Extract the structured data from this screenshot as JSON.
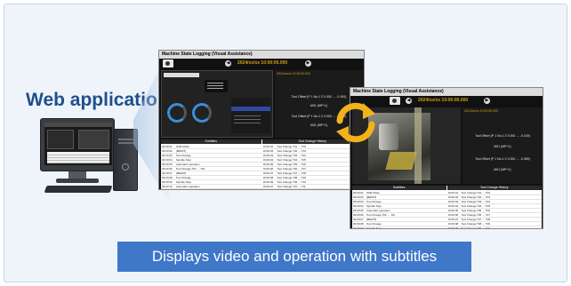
{
  "heading": "Web application",
  "caption": "Displays video and operation with subtitles",
  "window_main": {
    "title": "Machine State Logging (Visual Assistance)",
    "date": "2024/xx/xx 10:00:00.000",
    "info_top": "2024/xx/xx 10:00:00.000",
    "info_lines": [
      "Tool Offset (P 1 No.1 Z 0.000 → -0.100)",
      "M01 (MP+1)",
      "Tool Offset (P 1 No.1 Z 0.000 → -0.080)",
      "M01 (MP+1)"
    ]
  },
  "window_video": {
    "title": "Machine State Logging (Visual Assistance)",
    "date": "2024/xx/xx 10:00:00.000",
    "info_top": "2024/xx/xx 10:00:00.000",
    "info_lines": [
      "Tool Offset (P 1 No.1 Z 0.000 → -0.100)",
      "M01 (MP+1)",
      "Tool Offset (P 1 No.1 Z 0.000 → -0.080)",
      "M01 (MP+1)"
    ]
  },
  "table": {
    "col_subtitles": "Subtitles",
    "col_history": "Tool Change History",
    "rows": [
      {
        "t": "09:00:01",
        "s": "ONE Mode",
        "t2": "09:00:01",
        "h": "Tool Change T01 → T02"
      },
      {
        "t": "09:00:02",
        "s": "[MEM/T]",
        "t2": "09:00:02",
        "h": "Tool Change T02 → T03"
      },
      {
        "t": "09:00:03",
        "s": "Tool Change",
        "t2": "09:00:03",
        "h": "Tool Change T03 → T04"
      },
      {
        "t": "09:00:04",
        "s": "Spindle Stop",
        "t2": "09:00:04",
        "h": "Tool Change T04 → T05"
      },
      {
        "t": "09:00:05",
        "s": "Automatic operation",
        "t2": "09:00:05",
        "h": "Tool Change T05 → T06"
      },
      {
        "t": "09:00:06",
        "s": "Tool Change T02 → T03",
        "t2": "09:00:06",
        "h": "Tool Change T06 → T07"
      },
      {
        "t": "09:00:07",
        "s": "[MEM/T]",
        "t2": "09:00:07",
        "h": "Tool Change T07 → T08"
      },
      {
        "t": "09:00:08",
        "s": "Tool Change",
        "t2": "09:00:08",
        "h": "Tool Change T08 → T09"
      },
      {
        "t": "09:00:09",
        "s": "Spindle Stop",
        "t2": "09:00:09",
        "h": "Tool Change T09 → T10"
      },
      {
        "t": "09:00:10",
        "s": "Automatic operation",
        "t2": "09:00:10",
        "h": "Tool Change T10 → T11"
      }
    ]
  },
  "colors": {
    "heading": "#1f4e8c",
    "caption_bg": "#3f77c9",
    "accent_date": "#d4a017",
    "arrows": "#f2b21a"
  },
  "icons": [
    "camera-icon",
    "prev-arrow-icon",
    "next-arrow-icon",
    "cycle-arrows-icon",
    "desktop-computer-icon"
  ]
}
